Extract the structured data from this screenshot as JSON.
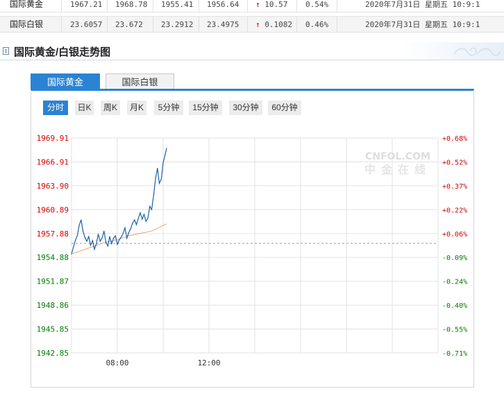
{
  "quotes": {
    "rows": [
      {
        "name": "国际黄金",
        "open": "1967.21",
        "high": "1968.78",
        "low": "1955.41",
        "last": "1956.64",
        "change": "10.57",
        "change_pct": "0.54%",
        "datetime": "2020年7月31日 星期五 10:9:1"
      },
      {
        "name": "国际白银",
        "open": "23.6057",
        "high": "23.672",
        "low": "23.2912",
        "last": "23.4975",
        "change": "0.1082",
        "change_pct": "0.46%",
        "datetime": "2020年7月31日 星期五 10:9:1"
      }
    ],
    "up_arrow": "↑"
  },
  "section": {
    "title": "国际黄金/白银走势图",
    "icon": "document-icon"
  },
  "tabs": [
    {
      "label": "国际黄金",
      "active": true
    },
    {
      "label": "国际白银",
      "active": false
    }
  ],
  "periods": [
    {
      "label": "分时",
      "active": true
    },
    {
      "label": "日K",
      "active": false
    },
    {
      "label": "周K",
      "active": false
    },
    {
      "label": "月K",
      "active": false
    },
    {
      "label": "5分钟",
      "active": false
    },
    {
      "label": "15分钟",
      "active": false
    },
    {
      "label": "30分钟",
      "active": false
    },
    {
      "label": "60分钟",
      "active": false
    }
  ],
  "colors": {
    "accent": "#2b83d3",
    "up": "#d40000",
    "down": "#007a00",
    "price_line": "#1a5fa8",
    "avg_line": "#f0a070",
    "grid": "#e2e2e2",
    "watermark": "#e6e6e6"
  },
  "chart_data": {
    "type": "line",
    "title": "",
    "xlabel": "",
    "ylabel": "",
    "watermark": "CNFOL.COM 中金在线",
    "y_left_ticks": [
      "1969.91",
      "1966.91",
      "1963.90",
      "1960.89",
      "1957.88",
      "1954.88",
      "1951.87",
      "1948.86",
      "1945.85",
      "1942.85"
    ],
    "y_right_ticks": [
      "+0.68%",
      "+0.52%",
      "+0.37%",
      "+0.22%",
      "+0.06%",
      "-0.09%",
      "-0.24%",
      "-0.40%",
      "-0.55%",
      "-0.71%"
    ],
    "ylim": [
      1942.85,
      1969.91
    ],
    "reference_price": 1956.64,
    "x_ticks": [
      "08:00",
      "12:00"
    ],
    "series": [
      {
        "type": "price",
        "x": [
          "06:00",
          "06:05",
          "06:10",
          "06:15",
          "06:20",
          "06:25",
          "06:30",
          "06:35",
          "06:40",
          "06:45",
          "06:50",
          "06:55",
          "07:00",
          "07:05",
          "07:10",
          "07:15",
          "07:20",
          "07:25",
          "07:30",
          "07:35",
          "07:40",
          "07:45",
          "07:50",
          "07:55",
          "08:00",
          "08:05",
          "08:10",
          "08:15",
          "08:20",
          "08:25",
          "08:30",
          "08:35",
          "08:40",
          "08:45",
          "08:50",
          "08:55",
          "09:00",
          "09:05",
          "09:10",
          "09:15",
          "09:20",
          "09:25",
          "09:30",
          "09:35",
          "09:40",
          "09:45",
          "09:50",
          "09:55",
          "10:00",
          "10:05",
          "10:09"
        ],
        "values": [
          1955.3,
          1956.2,
          1957.0,
          1957.6,
          1958.9,
          1959.6,
          1958.2,
          1957.4,
          1956.9,
          1957.5,
          1956.4,
          1957.0,
          1955.9,
          1956.6,
          1957.8,
          1956.9,
          1957.3,
          1958.2,
          1956.8,
          1956.3,
          1957.5,
          1956.6,
          1957.3,
          1957.6,
          1956.5,
          1957.1,
          1957.4,
          1957.9,
          1958.6,
          1957.3,
          1958.0,
          1958.5,
          1959.2,
          1959.6,
          1959.0,
          1959.8,
          1960.5,
          1959.7,
          1960.3,
          1959.4,
          1959.8,
          1961.3,
          1960.9,
          1962.7,
          1964.8,
          1966.1,
          1964.2,
          1964.7,
          1966.8,
          1967.8,
          1968.6
        ]
      },
      {
        "type": "average",
        "x": [
          "06:00",
          "07:00",
          "07:30",
          "08:00",
          "08:30",
          "09:00",
          "09:30",
          "10:09"
        ],
        "values": [
          1955.3,
          1956.3,
          1956.8,
          1957.1,
          1957.6,
          1957.9,
          1958.2,
          1959.1
        ]
      }
    ],
    "grid": true
  }
}
